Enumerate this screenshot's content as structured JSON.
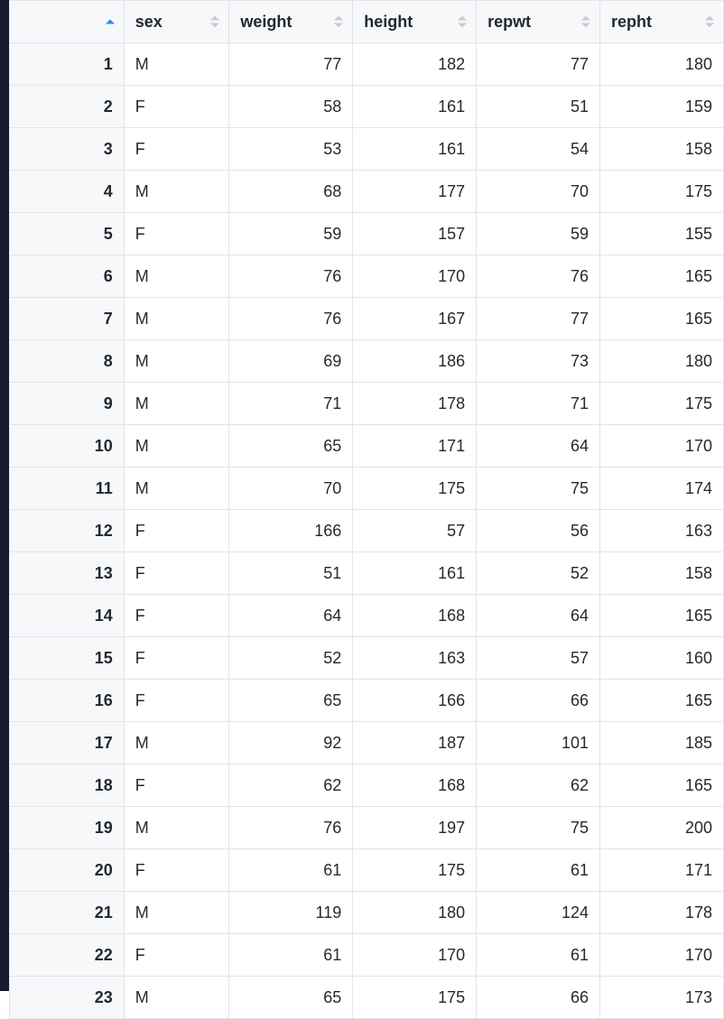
{
  "table": {
    "columns": [
      {
        "key": "index",
        "label": "",
        "sorted": "asc"
      },
      {
        "key": "sex",
        "label": "sex",
        "sorted": "none"
      },
      {
        "key": "weight",
        "label": "weight",
        "sorted": "none"
      },
      {
        "key": "height",
        "label": "height",
        "sorted": "none"
      },
      {
        "key": "repwt",
        "label": "repwt",
        "sorted": "none"
      },
      {
        "key": "repht",
        "label": "repht",
        "sorted": "none"
      }
    ],
    "rows": [
      {
        "index": "1",
        "sex": "M",
        "weight": "77",
        "height": "182",
        "repwt": "77",
        "repht": "180"
      },
      {
        "index": "2",
        "sex": "F",
        "weight": "58",
        "height": "161",
        "repwt": "51",
        "repht": "159"
      },
      {
        "index": "3",
        "sex": "F",
        "weight": "53",
        "height": "161",
        "repwt": "54",
        "repht": "158"
      },
      {
        "index": "4",
        "sex": "M",
        "weight": "68",
        "height": "177",
        "repwt": "70",
        "repht": "175"
      },
      {
        "index": "5",
        "sex": "F",
        "weight": "59",
        "height": "157",
        "repwt": "59",
        "repht": "155"
      },
      {
        "index": "6",
        "sex": "M",
        "weight": "76",
        "height": "170",
        "repwt": "76",
        "repht": "165"
      },
      {
        "index": "7",
        "sex": "M",
        "weight": "76",
        "height": "167",
        "repwt": "77",
        "repht": "165"
      },
      {
        "index": "8",
        "sex": "M",
        "weight": "69",
        "height": "186",
        "repwt": "73",
        "repht": "180"
      },
      {
        "index": "9",
        "sex": "M",
        "weight": "71",
        "height": "178",
        "repwt": "71",
        "repht": "175"
      },
      {
        "index": "10",
        "sex": "M",
        "weight": "65",
        "height": "171",
        "repwt": "64",
        "repht": "170"
      },
      {
        "index": "11",
        "sex": "M",
        "weight": "70",
        "height": "175",
        "repwt": "75",
        "repht": "174"
      },
      {
        "index": "12",
        "sex": "F",
        "weight": "166",
        "height": "57",
        "repwt": "56",
        "repht": "163"
      },
      {
        "index": "13",
        "sex": "F",
        "weight": "51",
        "height": "161",
        "repwt": "52",
        "repht": "158"
      },
      {
        "index": "14",
        "sex": "F",
        "weight": "64",
        "height": "168",
        "repwt": "64",
        "repht": "165"
      },
      {
        "index": "15",
        "sex": "F",
        "weight": "52",
        "height": "163",
        "repwt": "57",
        "repht": "160"
      },
      {
        "index": "16",
        "sex": "F",
        "weight": "65",
        "height": "166",
        "repwt": "66",
        "repht": "165"
      },
      {
        "index": "17",
        "sex": "M",
        "weight": "92",
        "height": "187",
        "repwt": "101",
        "repht": "185"
      },
      {
        "index": "18",
        "sex": "F",
        "weight": "62",
        "height": "168",
        "repwt": "62",
        "repht": "165"
      },
      {
        "index": "19",
        "sex": "M",
        "weight": "76",
        "height": "197",
        "repwt": "75",
        "repht": "200"
      },
      {
        "index": "20",
        "sex": "F",
        "weight": "61",
        "height": "175",
        "repwt": "61",
        "repht": "171"
      },
      {
        "index": "21",
        "sex": "M",
        "weight": "119",
        "height": "180",
        "repwt": "124",
        "repht": "178"
      },
      {
        "index": "22",
        "sex": "F",
        "weight": "61",
        "height": "170",
        "repwt": "61",
        "repht": "170"
      },
      {
        "index": "23",
        "sex": "M",
        "weight": "65",
        "height": "175",
        "repwt": "66",
        "repht": "173"
      }
    ]
  }
}
